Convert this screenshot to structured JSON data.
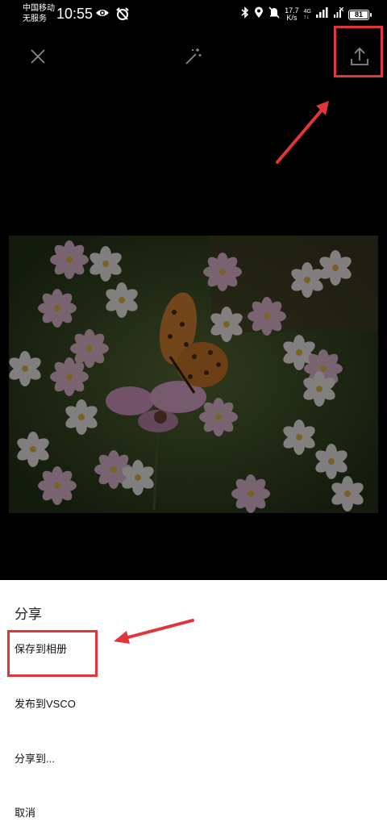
{
  "status_bar": {
    "carrier_line1": "中国移动",
    "carrier_line2": "无服务",
    "time": "10:55",
    "net_speed_value": "17.7",
    "net_speed_unit": "K/s",
    "net_type_top": "4G",
    "net_type_bottom": "↑↓",
    "battery": "81"
  },
  "toolbar": {
    "close_icon": "close-icon",
    "magic_icon": "magic-wand-icon",
    "export_icon": "share-upload-icon"
  },
  "sheet": {
    "title": "分享",
    "items": [
      {
        "label": "保存到相册"
      },
      {
        "label": "发布到VSCO"
      },
      {
        "label": "分享到..."
      },
      {
        "label": "取消"
      }
    ]
  },
  "colors": {
    "annotation_red": "#e0353b",
    "background": "#000000",
    "sheet_bg": "#ffffff"
  }
}
